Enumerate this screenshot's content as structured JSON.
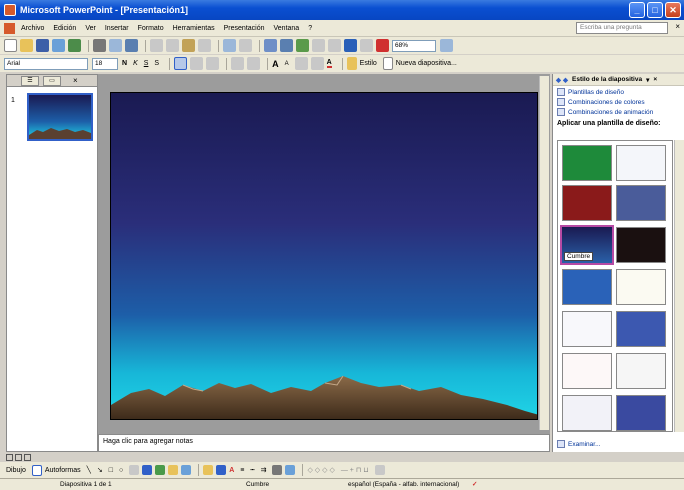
{
  "window": {
    "title": "Microsoft PowerPoint - [Presentación1]",
    "minimize": "_",
    "maximize": "□",
    "close": "✕"
  },
  "menu": {
    "items": [
      "Archivo",
      "Edición",
      "Ver",
      "Insertar",
      "Formato",
      "Herramientas",
      "Presentación",
      "Ventana",
      "?"
    ],
    "help_placeholder": "Escriba una pregunta",
    "close": "×"
  },
  "toolbar_standard": {
    "zoom": "68%"
  },
  "toolbar_format": {
    "font": "Arial",
    "size": "18",
    "bold": "N",
    "italic": "K",
    "underline": "S",
    "shadow": "S",
    "font_grow": "A",
    "font_shrink": "A",
    "font_color": "A",
    "design_button": "Estilo",
    "new_slide_button": "Nueva diapositiva..."
  },
  "left_pane": {
    "close": "×",
    "slide_number": "1"
  },
  "notes": {
    "placeholder": "Haga clic para agregar notas"
  },
  "task_pane": {
    "title": "Estilo de la diapositiva",
    "links": [
      "Plantillas de diseño",
      "Combinaciones de colores",
      "Combinaciones de animación"
    ],
    "section_title": "Aplicar una plantilla de diseño:",
    "selected_template": "Cumbre",
    "browse": "Examinar..."
  },
  "draw_toolbar": {
    "draw": "Dibujo",
    "autoshapes": "Autoformas"
  },
  "status": {
    "slide": "Diapositiva 1 de 1",
    "design": "Cumbre",
    "language": "español (España - alfab. internacional)"
  },
  "colors": {
    "accent": "#0a4fd1",
    "selection": "#b64aa4"
  }
}
